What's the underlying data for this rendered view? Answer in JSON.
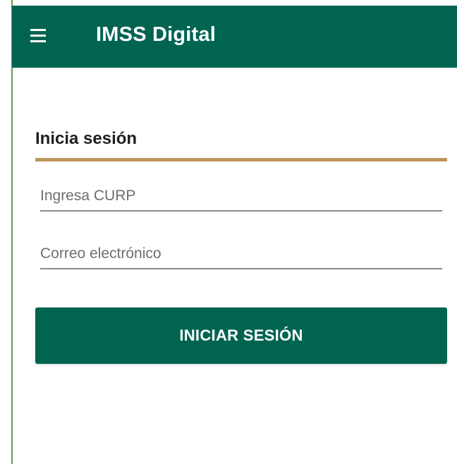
{
  "app_bar": {
    "title": "IMSS Digital",
    "menu_icon": "hamburger-menu-icon",
    "background_color": "#006451",
    "text_color": "#ffffff"
  },
  "login": {
    "heading": "Inicia sesión",
    "accent_color": "#bc955c",
    "curp_field": {
      "value": "",
      "placeholder": "Ingresa CURP"
    },
    "email_field": {
      "value": "",
      "placeholder": "Correo electrónico"
    },
    "submit_label": "INICIAR SESIÓN",
    "button_color": "#006451"
  }
}
